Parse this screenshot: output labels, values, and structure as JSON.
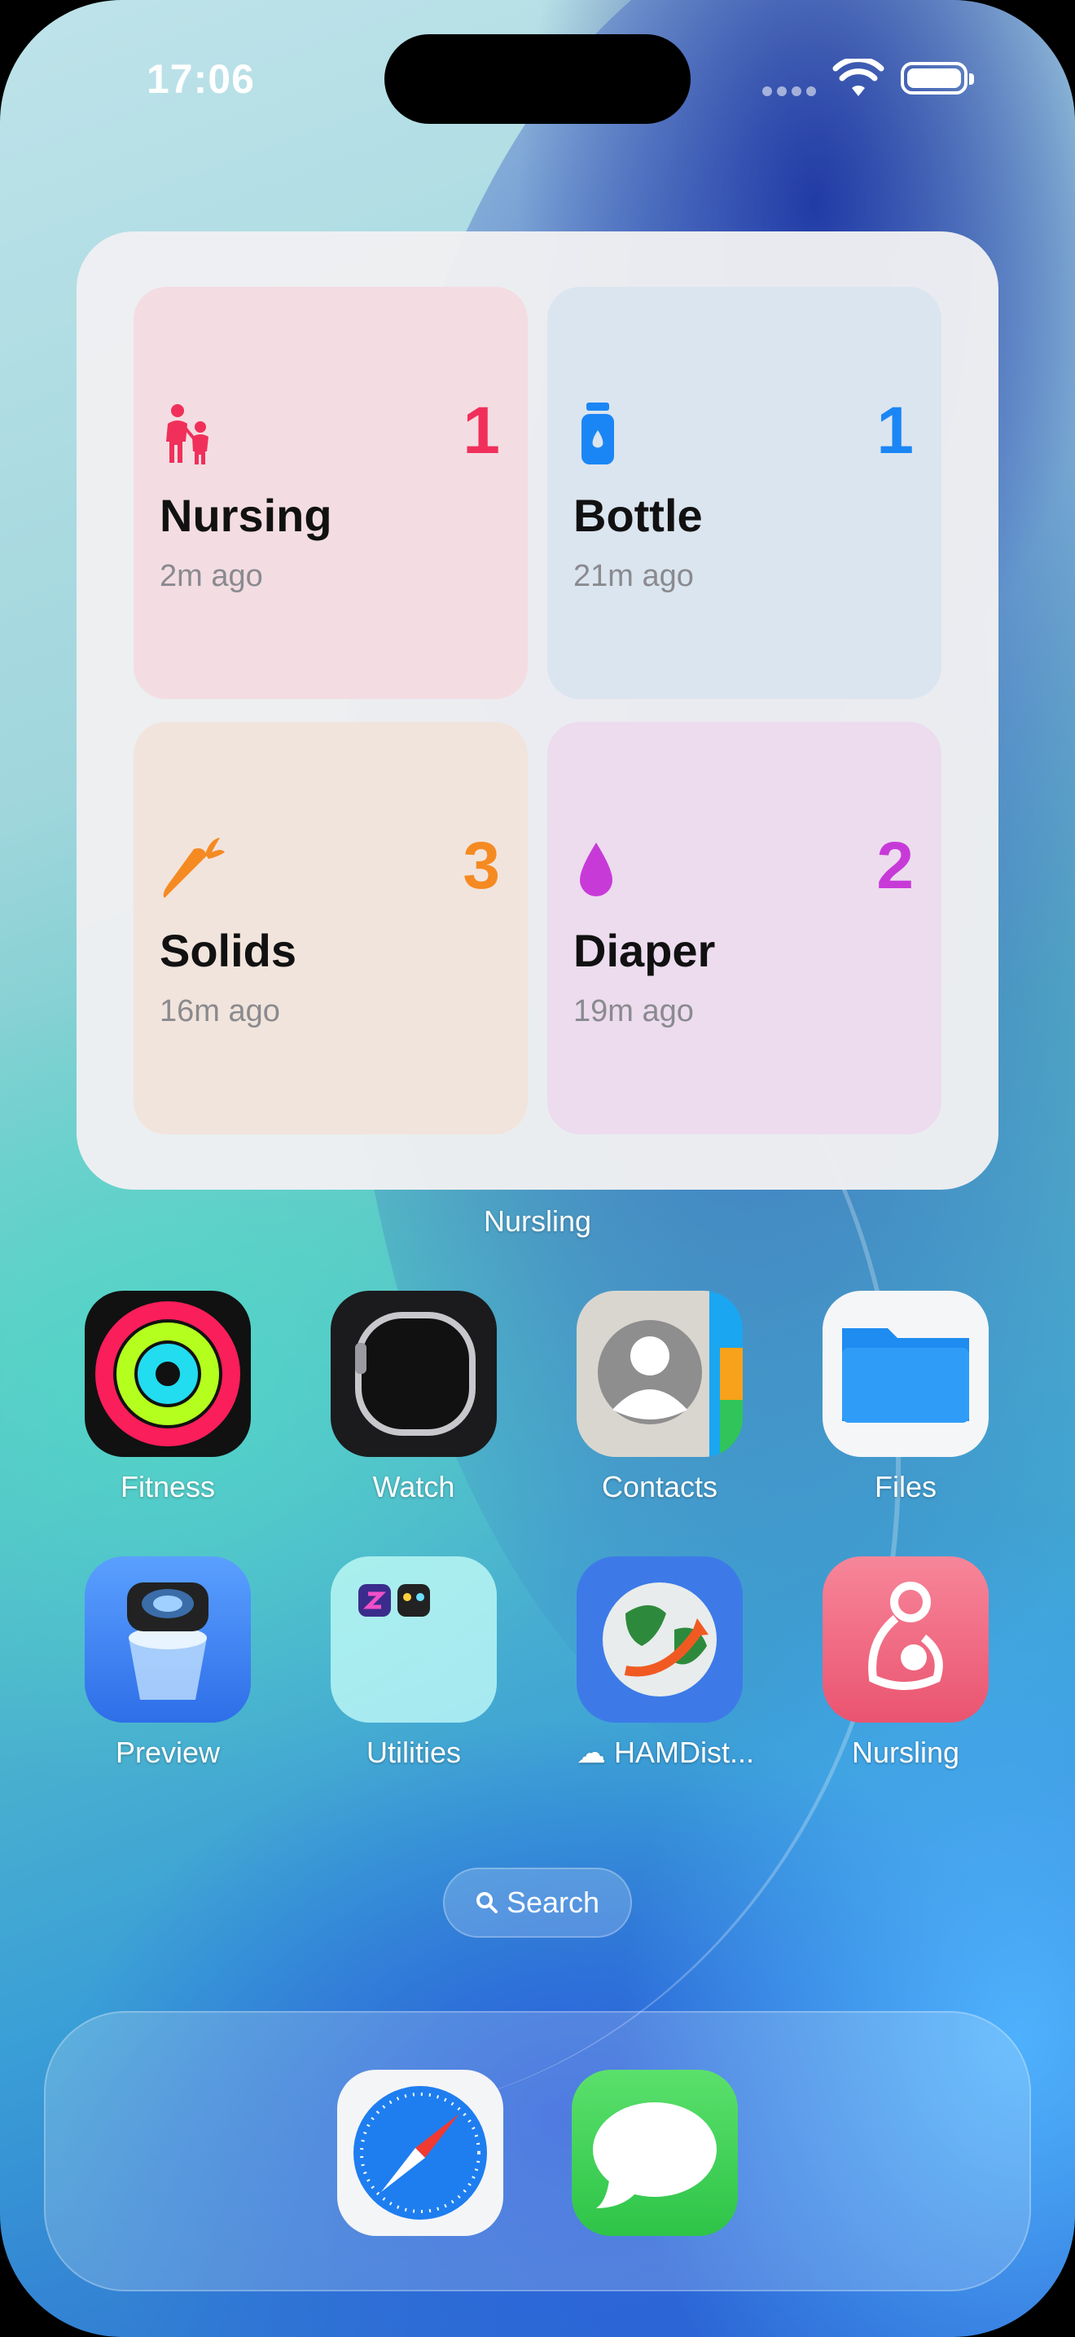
{
  "status_bar": {
    "time": "17:06"
  },
  "widget": {
    "label": "Nursling",
    "tiles": [
      {
        "name": "Nursing",
        "count": "1",
        "ago": "2m ago",
        "icon": "parent-child-icon",
        "accent": "#f0305a",
        "bg": "#f3dde2"
      },
      {
        "name": "Bottle",
        "count": "1",
        "ago": "21m ago",
        "icon": "bottle-icon",
        "accent": "#1a86f5",
        "bg": "#dbe5ef"
      },
      {
        "name": "Solids",
        "count": "3",
        "ago": "16m ago",
        "icon": "carrot-icon",
        "accent": "#f58a22",
        "bg": "#f1e4dc"
      },
      {
        "name": "Diaper",
        "count": "2",
        "ago": "19m ago",
        "icon": "drop-icon",
        "accent": "#c73ad8",
        "bg": "#ecdcee"
      }
    ]
  },
  "apps": {
    "row1": [
      "Fitness",
      "Watch",
      "Contacts",
      "Files"
    ],
    "row2": [
      "Preview",
      "Utilities",
      "HAMDist...",
      "Nursling"
    ]
  },
  "search": {
    "label": "Search"
  },
  "dock": {
    "apps": [
      "safari-icon",
      "messages-icon"
    ]
  }
}
